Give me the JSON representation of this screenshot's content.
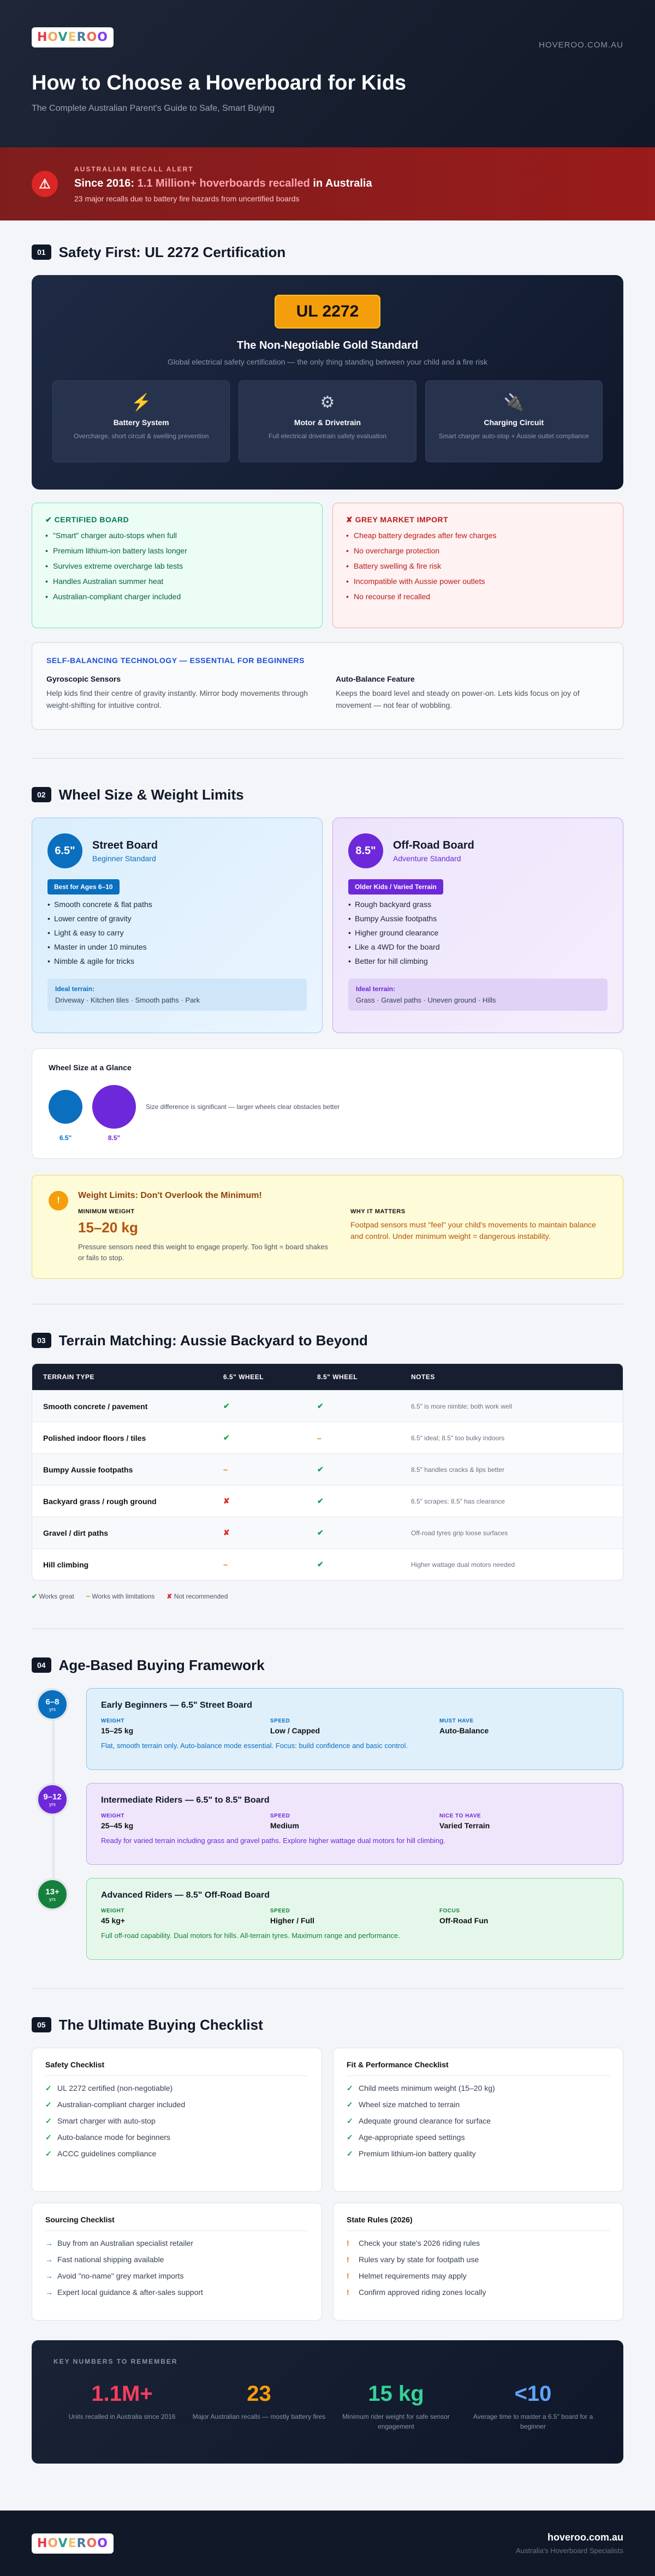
{
  "brand": {
    "logo": "HOVEROO",
    "site": "HOVEROO.COM.AU"
  },
  "header": {
    "title": "How to Choose a Hoverboard for Kids",
    "subtitle": "The Complete Australian Parent's Guide to Safe, Smart Buying"
  },
  "alert": {
    "kicker": "AUSTRALIAN RECALL ALERT",
    "title_pre": "Since 2016: ",
    "title_hl": "1.1 Million+ hoverboards recalled",
    "title_post": " in Australia",
    "desc": "23 major recalls due to battery fire hazards from uncertified boards"
  },
  "s1": {
    "num": "01",
    "title": "Safety First: UL 2272 Certification",
    "badge": "UL 2272",
    "card_title": "The Non-Negotiable Gold Standard",
    "card_desc": "Global electrical safety certification — the only thing standing between your child and a fire risk",
    "boxes": [
      {
        "icon": "⚡",
        "name": "Battery System",
        "desc": "Overcharge, short circuit & swelling prevention"
      },
      {
        "icon": "⚙",
        "name": "Motor & Drivetrain",
        "desc": "Full electrical drivetrain safety evaluation"
      },
      {
        "icon": "🔌",
        "name": "Charging Circuit",
        "desc": "Smart charger auto-stop + Aussie outlet compliance"
      }
    ],
    "good": {
      "title": "✔ CERTIFIED BOARD",
      "items": [
        "\"Smart\" charger auto-stops when full",
        "Premium lithium-ion battery lasts longer",
        "Survives extreme overcharge lab tests",
        "Handles Australian summer heat",
        "Australian-compliant charger included"
      ]
    },
    "bad": {
      "title": "✘ GREY MARKET IMPORT",
      "items": [
        "Cheap battery degrades after few charges",
        "No overcharge protection",
        "Battery swelling & fire risk",
        "Incompatible with Aussie power outlets",
        "No recourse if recalled"
      ]
    },
    "sbt": {
      "title": "SELF-BALANCING TECHNOLOGY — ESSENTIAL FOR BEGINNERS",
      "c1_name": "Gyroscopic Sensors",
      "c1_desc": "Help kids find their centre of gravity instantly. Mirror body movements through weight-shifting for intuitive control.",
      "c2_name": "Auto-Balance Feature",
      "c2_desc": "Keeps the board level and steady on power-on. Lets kids focus on joy of movement — not fear of wobbling."
    }
  },
  "s2": {
    "num": "02",
    "title": "Wheel Size & Weight Limits",
    "street": {
      "size": "6.5\"",
      "name": "Street Board",
      "sub": "Beginner Standard",
      "pill": "Best for Ages 6–10",
      "items": [
        "Smooth concrete & flat paths",
        "Lower centre of gravity",
        "Light & easy to carry",
        "Master in under 10 minutes",
        "Nimble & agile for tricks"
      ],
      "terr_h": "Ideal terrain:",
      "terr": "Driveway · Kitchen tiles · Smooth paths · Park"
    },
    "off": {
      "size": "8.5\"",
      "name": "Off-Road Board",
      "sub": "Adventure Standard",
      "pill": "Older Kids / Varied Terrain",
      "items": [
        "Rough backyard grass",
        "Bumpy Aussie footpaths",
        "Higher ground clearance",
        "Like a 4WD for the board",
        "Better for hill climbing"
      ],
      "terr_h": "Ideal terrain:",
      "terr": "Grass · Gravel paths · Uneven ground · Hills"
    },
    "glance": {
      "title": "Wheel Size at a Glance",
      "desc": "Size difference is significant — larger wheels clear obstacles better",
      "l1": "6.5\"",
      "l2": "8.5\""
    },
    "weight": {
      "icon": "!",
      "title": "Weight Limits: Don't Overlook the Minimum!",
      "k1": "MINIMUM WEIGHT",
      "v1": "15–20 kg",
      "d1": "Pressure sensors need this weight to engage properly. Too light = board shakes or fails to stop.",
      "k2": "WHY IT MATTERS",
      "d2": "Footpad sensors must \"feel\" your child's movements to maintain balance and control. Under minimum weight = dangerous instability."
    }
  },
  "s3": {
    "num": "03",
    "title": "Terrain Matching: Aussie Backyard to Beyond",
    "headers": [
      "TERRAIN TYPE",
      "6.5\" WHEEL",
      "8.5\" WHEEL",
      "NOTES"
    ],
    "rows": [
      [
        "Smooth concrete / pavement",
        "✔",
        "✔",
        "6.5\" is more nimble; both work well"
      ],
      [
        "Polished indoor floors / tiles",
        "✔",
        "–",
        "6.5\" ideal; 8.5\" too bulky indoors"
      ],
      [
        "Bumpy Aussie footpaths",
        "~",
        "✔",
        "8.5\" handles cracks & lips better"
      ],
      [
        "Backyard grass / rough ground",
        "✘",
        "✔",
        "6.5\" scrapes; 8.5\" has clearance"
      ],
      [
        "Gravel / dirt paths",
        "✘",
        "✔",
        "Off-road tyres grip loose surfaces"
      ],
      [
        "Hill climbing",
        "~",
        "✔",
        "Higher wattage dual motors needed"
      ]
    ],
    "legend": [
      "Works great",
      "Works with limitations",
      "Not recommended"
    ]
  },
  "s4": {
    "num": "04",
    "title": "Age-Based Buying Framework",
    "tiers": [
      {
        "age": "6–8",
        "unit": "yrs",
        "title": "Early Beginners — 6.5\" Street Board",
        "k1": "WEIGHT",
        "v1": "15–25 kg",
        "k2": "SPEED",
        "v2": "Low / Capped",
        "k3": "MUST HAVE",
        "v3": "Auto-Balance",
        "desc": "Flat, smooth terrain only. Auto-balance mode essential. Focus: build confidence and basic control."
      },
      {
        "age": "9–12",
        "unit": "yrs",
        "title": "Intermediate Riders — 6.5\" to 8.5\" Board",
        "k1": "WEIGHT",
        "v1": "25–45 kg",
        "k2": "SPEED",
        "v2": "Medium",
        "k3": "NICE TO HAVE",
        "v3": "Varied Terrain",
        "desc": "Ready for varied terrain including grass and gravel paths. Explore higher wattage dual motors for hill climbing."
      },
      {
        "age": "13+",
        "unit": "yrs",
        "title": "Advanced Riders — 8.5\" Off-Road Board",
        "k1": "WEIGHT",
        "v1": "45 kg+",
        "k2": "SPEED",
        "v2": "Higher / Full",
        "k3": "FOCUS",
        "v3": "Off-Road Fun",
        "desc": "Full off-road capability. Dual motors for hills. All-terrain tyres. Maximum range and performance."
      }
    ]
  },
  "s5": {
    "num": "05",
    "title": "The Ultimate Buying Checklist",
    "safety": {
      "title": "Safety Checklist",
      "items": [
        "UL 2272 certified (non-negotiable)",
        "Australian-compliant charger included",
        "Smart charger with auto-stop",
        "Auto-balance mode for beginners",
        "ACCC guidelines compliance"
      ]
    },
    "fit": {
      "title": "Fit & Performance Checklist",
      "items": [
        "Child meets minimum weight (15–20 kg)",
        "Wheel size matched to terrain",
        "Adequate ground clearance for surface",
        "Age-appropriate speed settings",
        "Premium lithium-ion battery quality"
      ]
    },
    "sourcing": {
      "title": "Sourcing Checklist",
      "items": [
        "Buy from an Australian specialist retailer",
        "Fast national shipping available",
        "Avoid \"no-name\" grey market imports",
        "Expert local guidance & after-sales support"
      ]
    },
    "state": {
      "title": "State Rules (2026)",
      "items": [
        "Check your state's 2026 riding rules",
        "Rules vary by state for footpath use",
        "Helmet requirements may apply",
        "Confirm approved riding zones locally"
      ]
    },
    "nums": {
      "title": "KEY NUMBERS TO REMEMBER",
      "items": [
        {
          "v": "1.1M+",
          "d": "Units recalled in Australia since 2016",
          "color": "#f43f5e"
        },
        {
          "v": "23",
          "d": "Major Australian recalls — mostly battery fires",
          "color": "#f59e0b"
        },
        {
          "v": "15 kg",
          "d": "Minimum rider weight for safe sensor engagement",
          "color": "#34d399"
        },
        {
          "v": "<10",
          "d": "Average time to master a 6.5\" board for a beginner",
          "color": "#60a5fa"
        }
      ]
    }
  },
  "footer": {
    "logo": "HOVEROO",
    "site": "hoveroo.com.au",
    "tag": "Australia's Hoverboard Specialists"
  }
}
